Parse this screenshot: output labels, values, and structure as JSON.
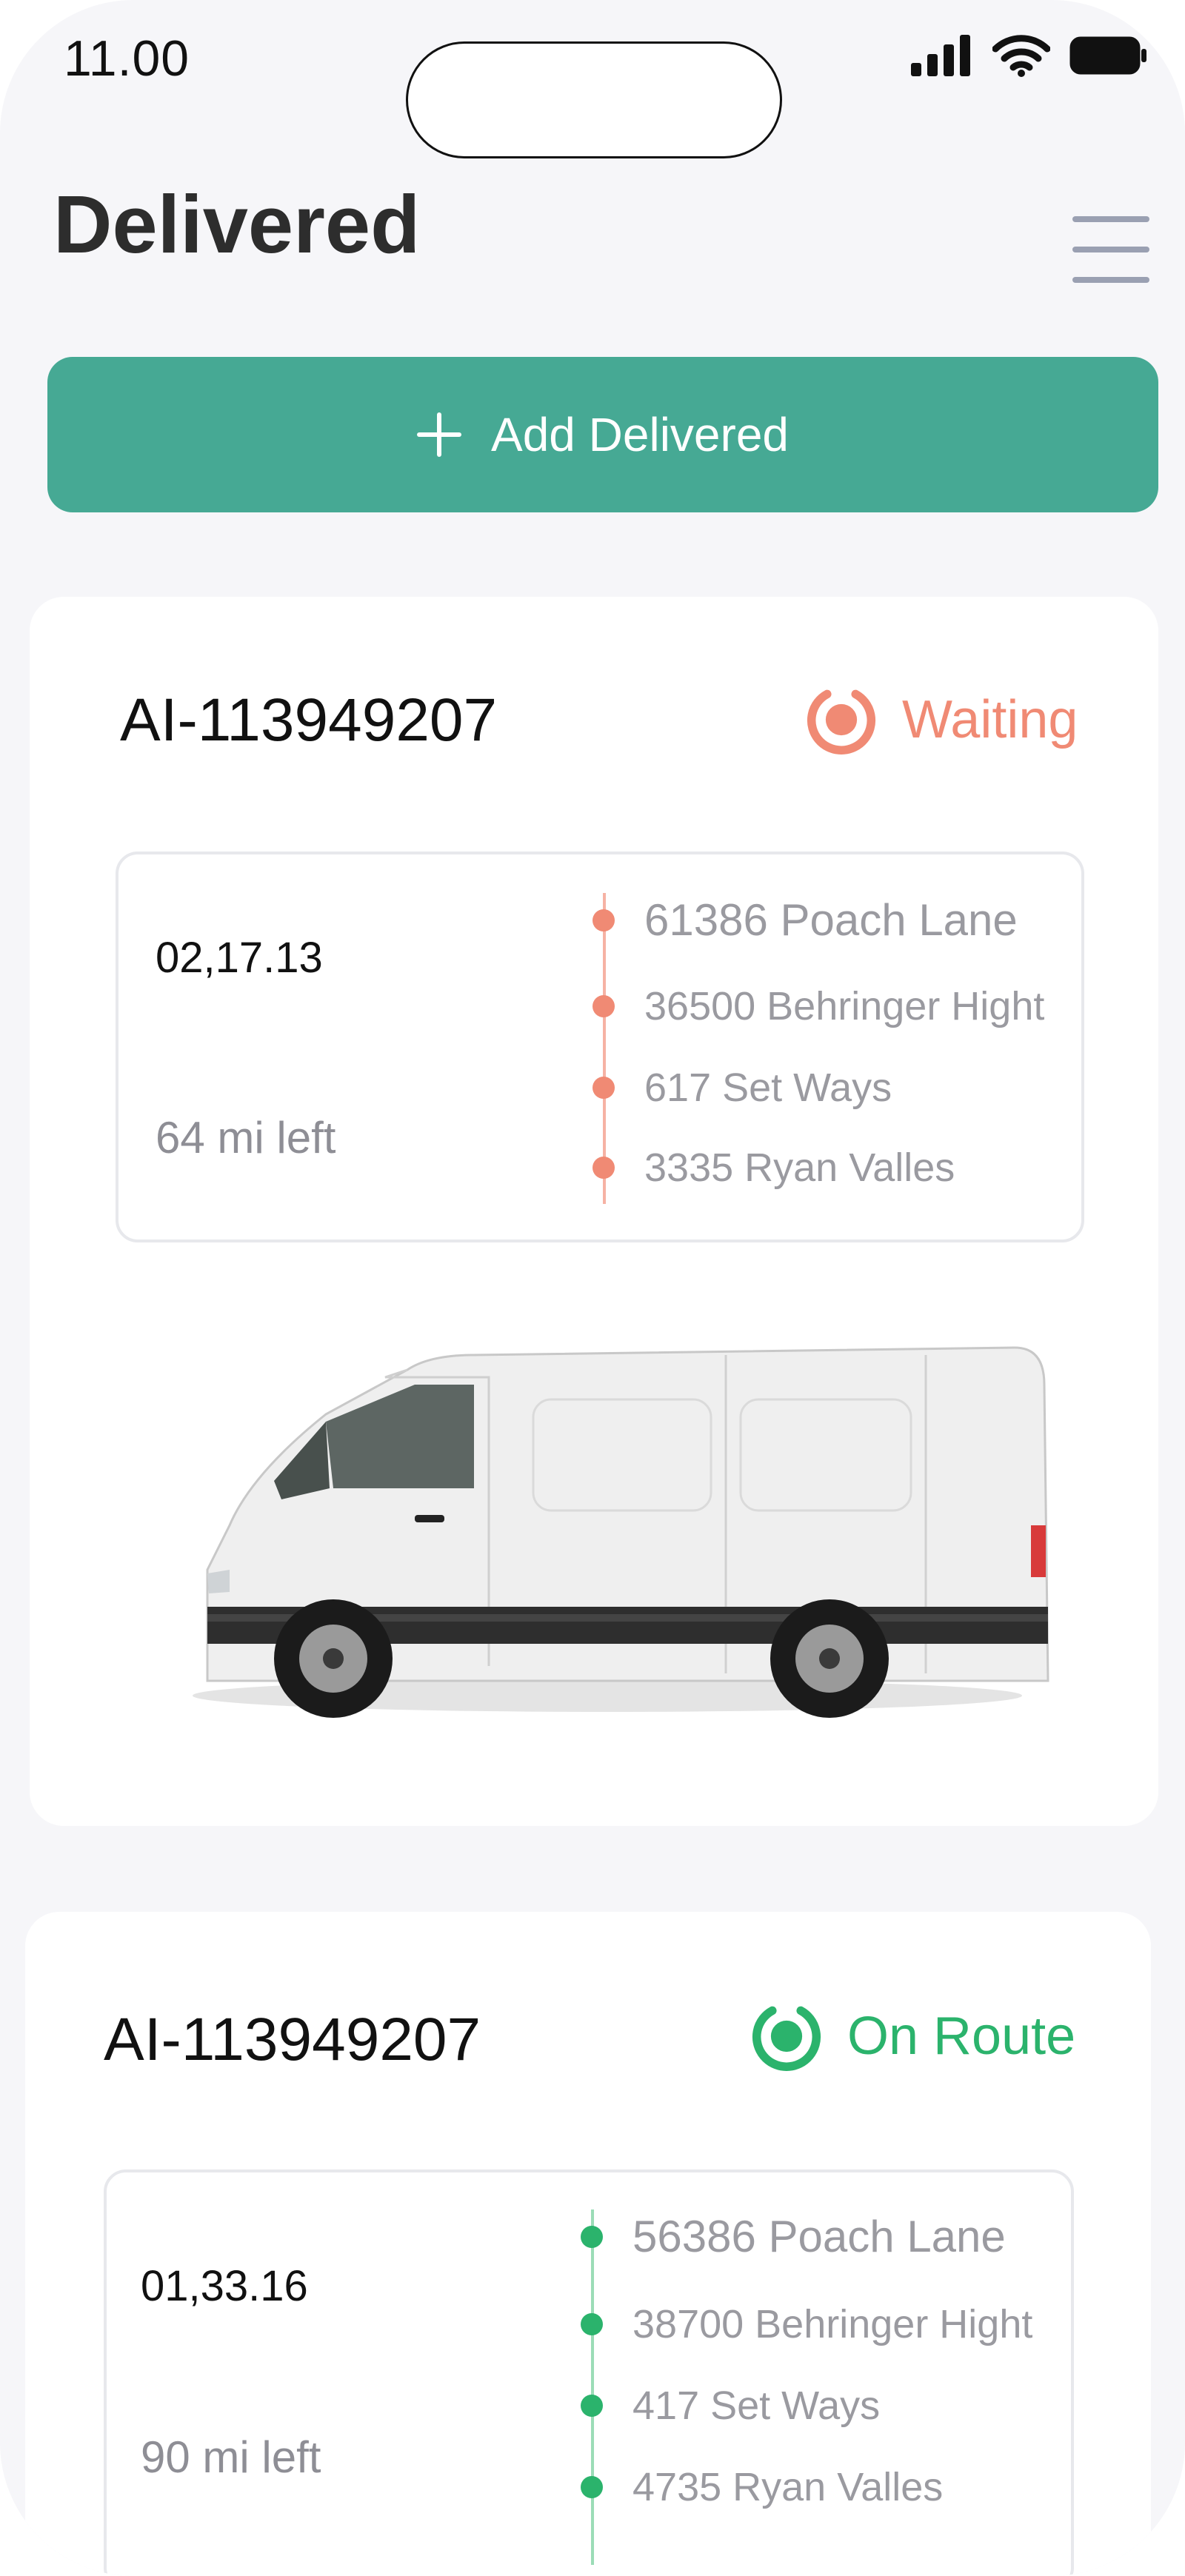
{
  "status_bar": {
    "time": "11.00"
  },
  "header": {
    "title": "Delivered"
  },
  "add_button": {
    "label": "Add Delivered"
  },
  "colors": {
    "accent": "#46a994",
    "waiting": "#f08a74",
    "on_route": "#2bb36c"
  },
  "deliveries": [
    {
      "id": "AI-113949207",
      "status": "Waiting",
      "time": "02,17.13",
      "distance": "64 mi left",
      "stops": [
        "61386 Poach Lane",
        "36500 Behringer Hight",
        "617 Set Ways",
        "3335 Ryan Valles"
      ]
    },
    {
      "id": "AI-113949207",
      "status": "On Route",
      "time": "01,33.16",
      "distance": "90 mi left",
      "stops": [
        "56386 Poach Lane",
        "38700 Behringer Hight",
        "417 Set Ways",
        "4735 Ryan Valles"
      ]
    }
  ]
}
